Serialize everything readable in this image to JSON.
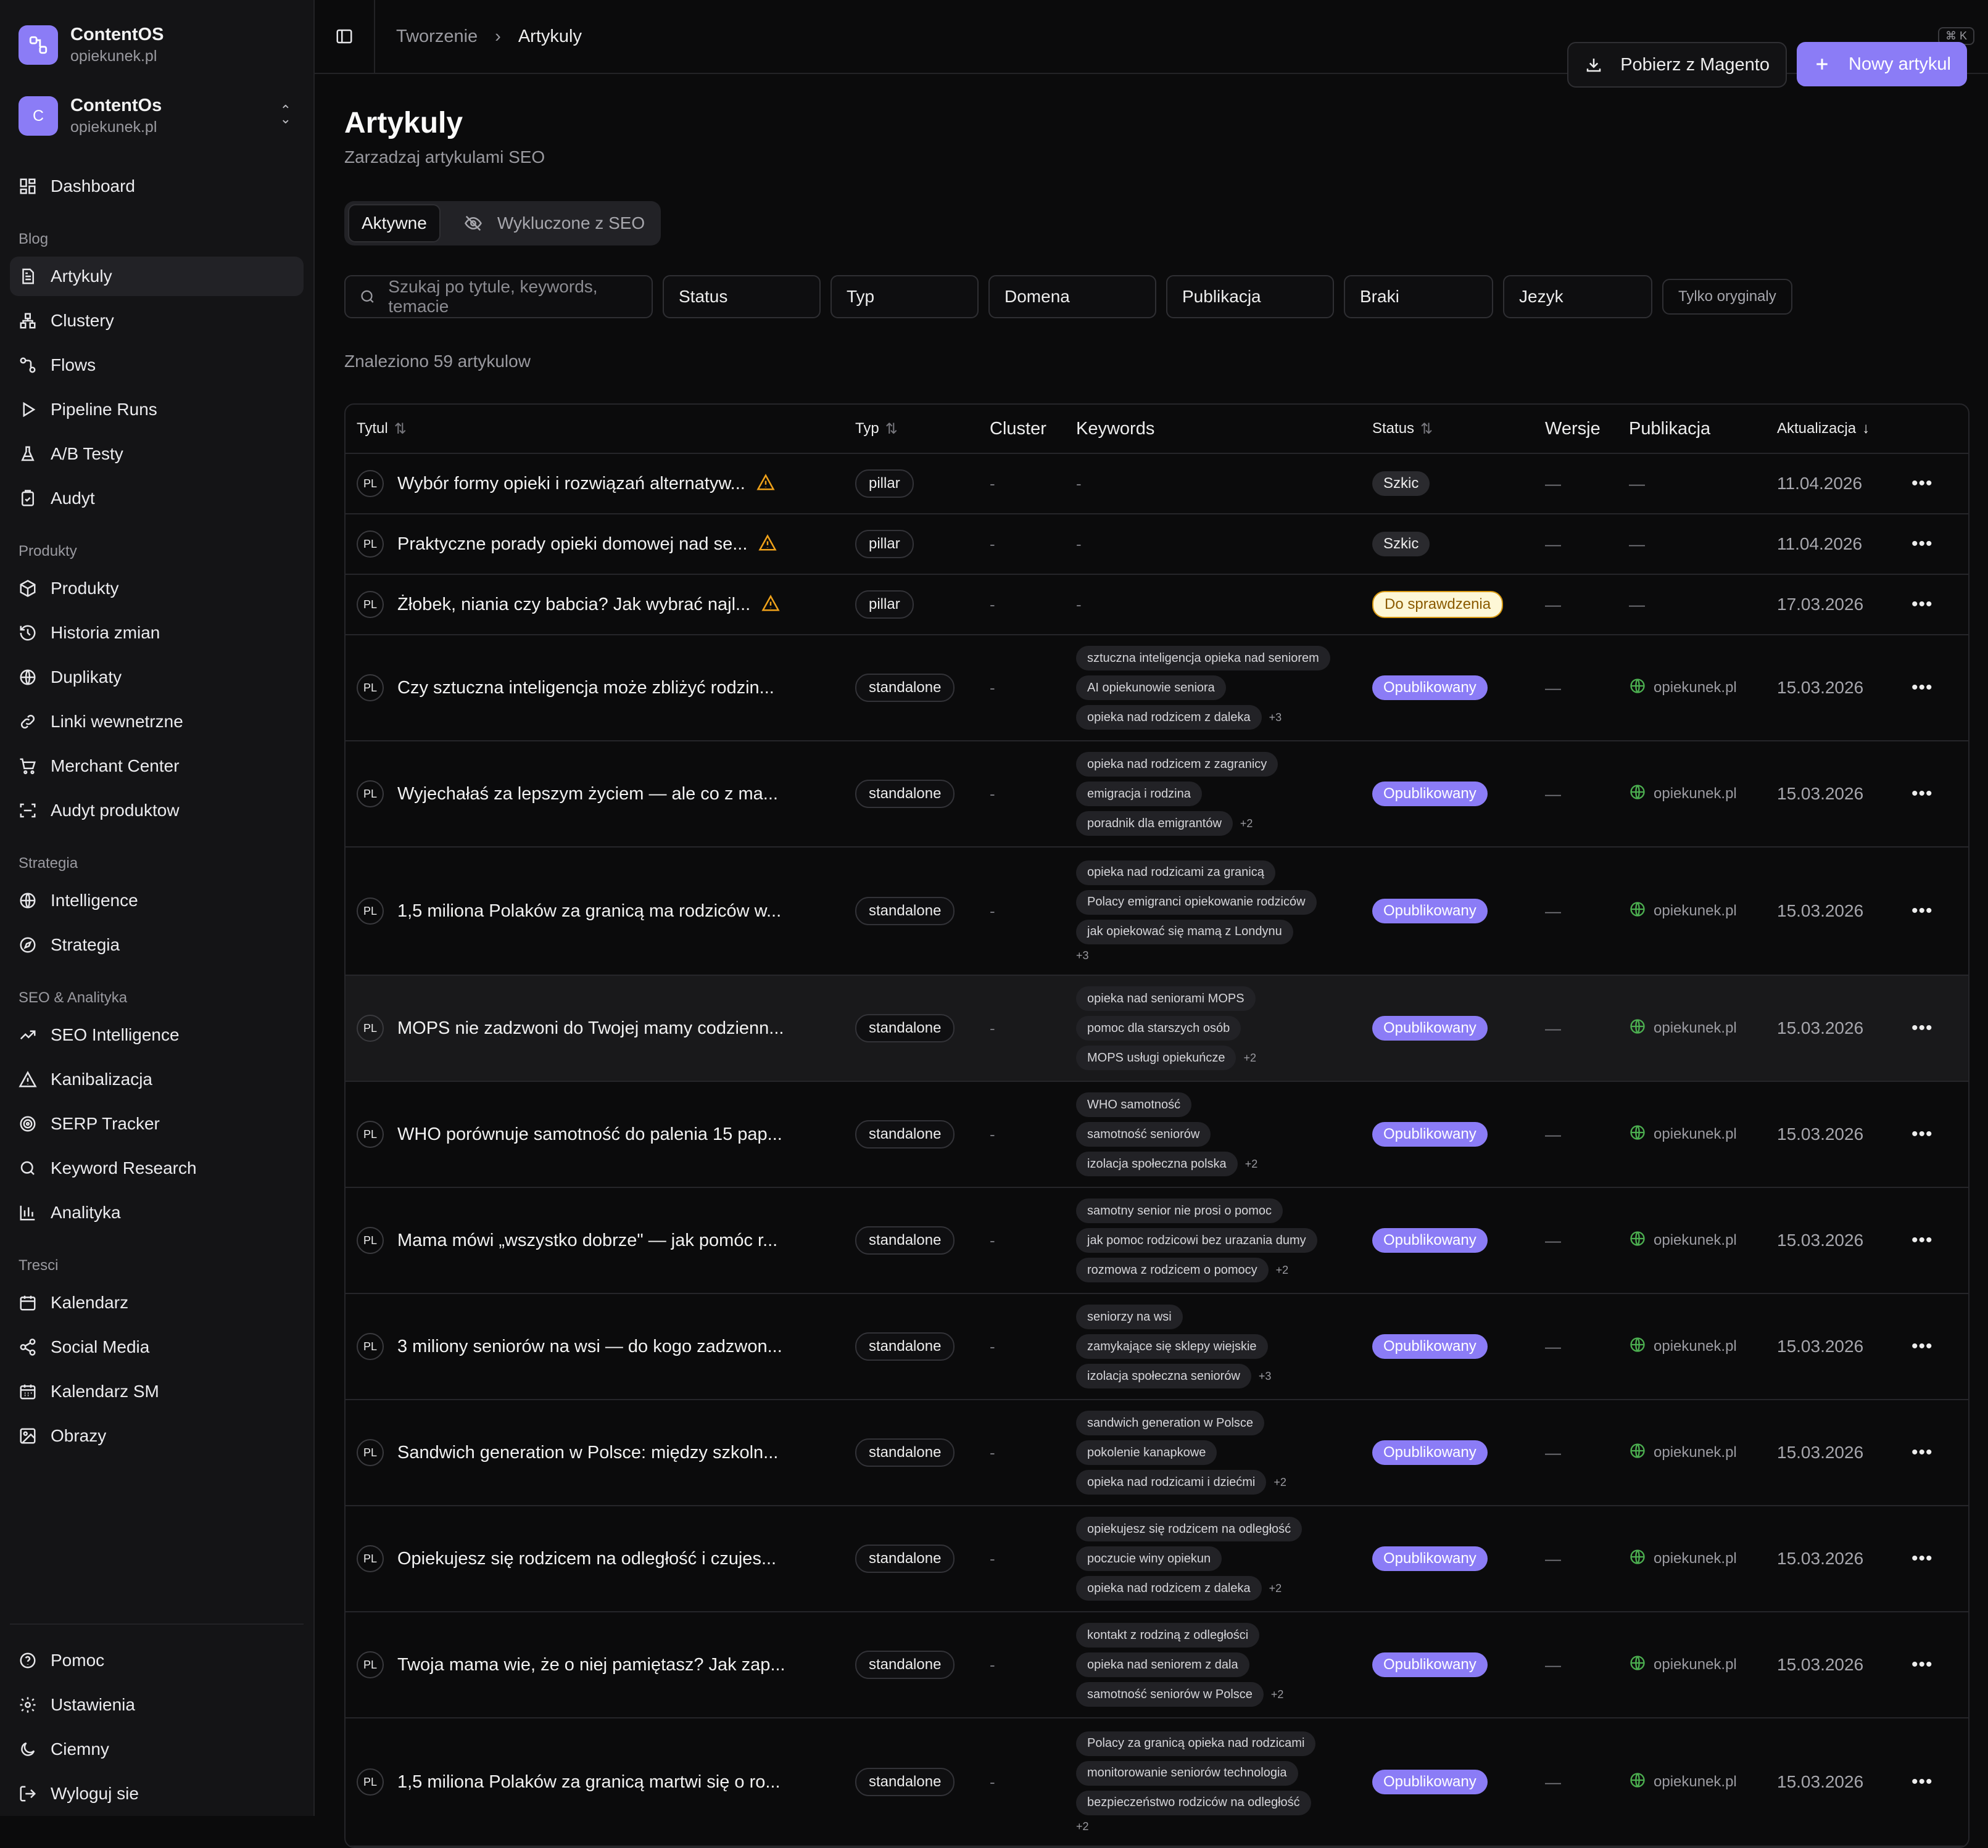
{
  "brand": {
    "name": "ContentOS",
    "domain": "opiekunek.pl"
  },
  "workspace": {
    "name": "ContentOs",
    "domain": "opiekunek.pl",
    "initial": "C"
  },
  "nav_top": [
    {
      "label": "Dashboard",
      "icon": "dashboard-icon"
    }
  ],
  "sections": [
    {
      "title": "Blog",
      "items": [
        {
          "label": "Artykuly",
          "icon": "article-icon",
          "active": true
        },
        {
          "label": "Clustery",
          "icon": "cluster-icon"
        },
        {
          "label": "Flows",
          "icon": "flow-icon"
        },
        {
          "label": "Pipeline Runs",
          "icon": "play-icon"
        },
        {
          "label": "A/B Testy",
          "icon": "flask-icon"
        },
        {
          "label": "Audyt",
          "icon": "clipboard-check-icon"
        }
      ]
    },
    {
      "title": "Produkty",
      "items": [
        {
          "label": "Produkty",
          "icon": "box-icon"
        },
        {
          "label": "Historia zmian",
          "icon": "history-icon"
        },
        {
          "label": "Duplikaty",
          "icon": "globe-icon"
        },
        {
          "label": "Linki wewnetrzne",
          "icon": "link-icon"
        },
        {
          "label": "Merchant Center",
          "icon": "cart-icon"
        },
        {
          "label": "Audyt produktow",
          "icon": "scan-icon"
        }
      ]
    },
    {
      "title": "Strategia",
      "items": [
        {
          "label": "Intelligence",
          "icon": "globe-icon"
        },
        {
          "label": "Strategia",
          "icon": "compass-icon"
        }
      ]
    },
    {
      "title": "SEO & Analityka",
      "items": [
        {
          "label": "SEO Intelligence",
          "icon": "trending-up-icon"
        },
        {
          "label": "Kanibalizacja",
          "icon": "warning-icon"
        },
        {
          "label": "SERP Tracker",
          "icon": "target-icon"
        },
        {
          "label": "Keyword Research",
          "icon": "search-icon"
        },
        {
          "label": "Analityka",
          "icon": "bar-chart-icon"
        }
      ]
    },
    {
      "title": "Tresci",
      "items": [
        {
          "label": "Kalendarz",
          "icon": "calendar-icon"
        },
        {
          "label": "Social Media",
          "icon": "share-icon"
        },
        {
          "label": "Kalendarz SM",
          "icon": "calendar-grid-icon"
        },
        {
          "label": "Obrazy",
          "icon": "image-icon"
        }
      ]
    }
  ],
  "nav_bottom": [
    {
      "label": "Pomoc",
      "icon": "help-icon"
    },
    {
      "label": "Ustawienia",
      "icon": "gear-icon"
    },
    {
      "label": "Ciemny",
      "icon": "moon-icon"
    },
    {
      "label": "Wyloguj sie",
      "icon": "logout-icon"
    }
  ],
  "breadcrumb": {
    "parent": "Tworzenie",
    "current": "Artykuly",
    "shortcut": "⌘ K"
  },
  "page": {
    "title": "Artykuly",
    "subtitle": "Zarzadzaj artykulami SEO"
  },
  "actions": {
    "import_label": "Pobierz z Magento",
    "new_label": "Nowy artykul"
  },
  "tabs": {
    "active": "Aktywne",
    "excluded": "Wykluczone z SEO"
  },
  "filters": {
    "search_placeholder": "Szukaj po tytule, keywords, temacie",
    "status": "Status",
    "type": "Typ",
    "domain": "Domena",
    "publication": "Publikacja",
    "missing": "Braki",
    "language": "Jezyk",
    "originals": "Tylko oryginaly"
  },
  "result_count": "Znaleziono 59 artykulow",
  "columns": {
    "title": "Tytul",
    "type": "Typ",
    "cluster": "Cluster",
    "keywords": "Keywords",
    "status": "Status",
    "versions": "Wersje",
    "publication": "Publikacja",
    "updated": "Aktualizacja"
  },
  "colors": {
    "accent": "#8b7cf6",
    "warning": "#f0a21a",
    "globe": "#4caf50"
  },
  "rows": [
    {
      "lang": "PL",
      "title": "Wybór formy opieki i rozwiązań alternatyw...",
      "warn": true,
      "type": "pillar",
      "cluster": "-",
      "keywords": [],
      "kw_dash": "-",
      "more": "",
      "status": "Szkic",
      "status_kind": "draft",
      "versions": "—",
      "publication": "—",
      "date": "11.04.2026"
    },
    {
      "lang": "PL",
      "title": "Praktyczne porady opieki domowej nad se...",
      "warn": true,
      "type": "pillar",
      "cluster": "-",
      "keywords": [],
      "kw_dash": "-",
      "more": "",
      "status": "Szkic",
      "status_kind": "draft",
      "versions": "—",
      "publication": "—",
      "date": "11.04.2026"
    },
    {
      "lang": "PL",
      "title": "Żłobek, niania czy babcia? Jak wybrać najl...",
      "warn": true,
      "type": "pillar",
      "cluster": "-",
      "keywords": [],
      "kw_dash": "-",
      "more": "",
      "status": "Do sprawdzenia",
      "status_kind": "review",
      "versions": "—",
      "publication": "—",
      "date": "17.03.2026"
    },
    {
      "lang": "PL",
      "title": "Czy sztuczna inteligencja może zbliżyć rodzin...",
      "warn": false,
      "type": "standalone",
      "cluster": "-",
      "keywords": [
        "sztuczna inteligencja opieka nad seniorem",
        "AI opiekunowie seniora",
        "opieka nad rodzicem z daleka"
      ],
      "more": "+3",
      "status": "Opublikowany",
      "status_kind": "pub",
      "versions": "—",
      "publication": "opiekunek.pl",
      "date": "15.03.2026"
    },
    {
      "lang": "PL",
      "title": "Wyjechałaś za lepszym życiem — ale co z ma...",
      "warn": false,
      "type": "standalone",
      "cluster": "-",
      "keywords": [
        "opieka nad rodzicem z zagranicy",
        "emigracja i rodzina",
        "poradnik dla emigrantów"
      ],
      "more": "+2",
      "status": "Opublikowany",
      "status_kind": "pub",
      "versions": "—",
      "publication": "opiekunek.pl",
      "date": "15.03.2026"
    },
    {
      "lang": "PL",
      "title": "1,5 miliona Polaków za granicą ma rodziców w...",
      "warn": false,
      "type": "standalone",
      "cluster": "-",
      "keywords": [
        "opieka nad rodzicami za granicą",
        "Polacy emigranci opiekowanie rodziców",
        "jak opiekować się mamą z Londynu"
      ],
      "more": "+3",
      "more_below": true,
      "status": "Opublikowany",
      "status_kind": "pub",
      "versions": "—",
      "publication": "opiekunek.pl",
      "date": "15.03.2026"
    },
    {
      "lang": "PL",
      "title": "MOPS nie zadzwoni do Twojej mamy codzienn...",
      "warn": false,
      "type": "standalone",
      "cluster": "-",
      "keywords": [
        "opieka nad seniorami MOPS",
        "pomoc dla starszych osób",
        "MOPS usługi opiekuńcze"
      ],
      "more": "+2",
      "status": "Opublikowany",
      "status_kind": "pub",
      "versions": "—",
      "publication": "opiekunek.pl",
      "date": "15.03.2026",
      "highlight": true
    },
    {
      "lang": "PL",
      "title": "WHO porównuje samotność do palenia 15 pap...",
      "warn": false,
      "type": "standalone",
      "cluster": "-",
      "keywords": [
        "WHO samotność",
        "samotność seniorów",
        "izolacja społeczna polska"
      ],
      "more": "+2",
      "status": "Opublikowany",
      "status_kind": "pub",
      "versions": "—",
      "publication": "opiekunek.pl",
      "date": "15.03.2026"
    },
    {
      "lang": "PL",
      "title": "Mama mówi „wszystko dobrze\" — jak pomóc r...",
      "warn": false,
      "type": "standalone",
      "cluster": "-",
      "keywords": [
        "samotny senior nie prosi o pomoc",
        "jak pomoc rodzicowi bez urazania dumy",
        "rozmowa z rodzicem o pomocy"
      ],
      "more": "+2",
      "status": "Opublikowany",
      "status_kind": "pub",
      "versions": "—",
      "publication": "opiekunek.pl",
      "date": "15.03.2026"
    },
    {
      "lang": "PL",
      "title": "3 miliony seniorów na wsi — do kogo zadzwon...",
      "warn": false,
      "type": "standalone",
      "cluster": "-",
      "keywords": [
        "seniorzy na wsi",
        "zamykające się sklepy wiejskie",
        "izolacja społeczna seniorów"
      ],
      "more": "+3",
      "status": "Opublikowany",
      "status_kind": "pub",
      "versions": "—",
      "publication": "opiekunek.pl",
      "date": "15.03.2026"
    },
    {
      "lang": "PL",
      "title": "Sandwich generation w Polsce: między szkoln...",
      "warn": false,
      "type": "standalone",
      "cluster": "-",
      "keywords": [
        "sandwich generation w Polsce",
        "pokolenie kanapkowe",
        "opieka nad rodzicami i dziećmi"
      ],
      "more": "+2",
      "status": "Opublikowany",
      "status_kind": "pub",
      "versions": "—",
      "publication": "opiekunek.pl",
      "date": "15.03.2026"
    },
    {
      "lang": "PL",
      "title": "Opiekujesz się rodzicem na odległość i czujes...",
      "warn": false,
      "type": "standalone",
      "cluster": "-",
      "keywords": [
        "opiekujesz się rodzicem na odległość",
        "poczucie winy opiekun",
        "opieka nad rodzicem z daleka"
      ],
      "more": "+2",
      "status": "Opublikowany",
      "status_kind": "pub",
      "versions": "—",
      "publication": "opiekunek.pl",
      "date": "15.03.2026"
    },
    {
      "lang": "PL",
      "title": "Twoja mama wie, że o niej pamiętasz? Jak zap...",
      "warn": false,
      "type": "standalone",
      "cluster": "-",
      "keywords": [
        "kontakt z rodziną z odległości",
        "opieka nad seniorem z dala",
        "samotność seniorów w Polsce"
      ],
      "more": "+2",
      "status": "Opublikowany",
      "status_kind": "pub",
      "versions": "—",
      "publication": "opiekunek.pl",
      "date": "15.03.2026"
    },
    {
      "lang": "PL",
      "title": "1,5 miliona Polaków za granicą martwi się o ro...",
      "warn": false,
      "type": "standalone",
      "cluster": "-",
      "keywords": [
        "Polacy za granicą opieka nad rodzicami",
        "monitorowanie seniorów technologia",
        "bezpieczeństwo rodziców na odległość"
      ],
      "more": "+2",
      "more_below": true,
      "status": "Opublikowany",
      "status_kind": "pub",
      "versions": "—",
      "publication": "opiekunek.pl",
      "date": "15.03.2026"
    }
  ]
}
